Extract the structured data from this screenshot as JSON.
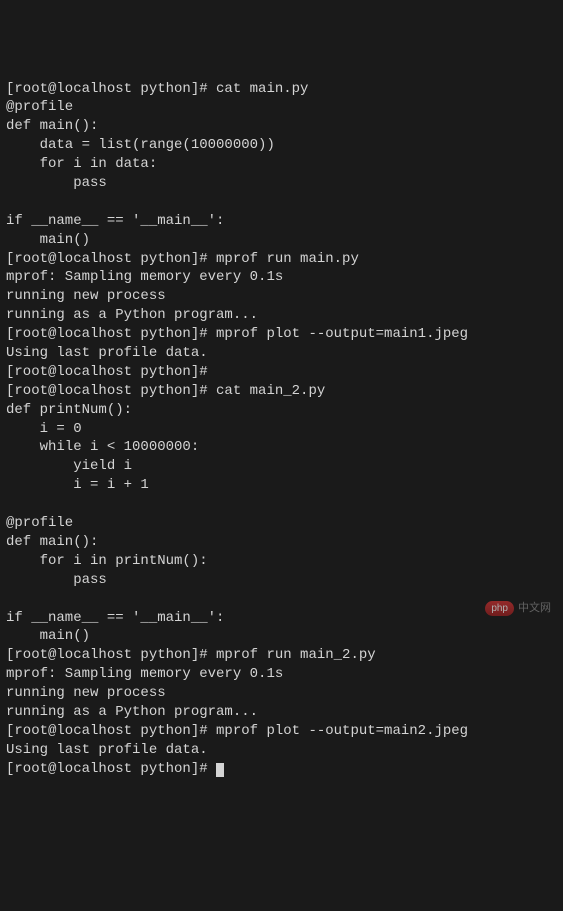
{
  "terminal": {
    "lines": [
      "[root@localhost python]# cat main.py",
      "@profile",
      "def main():",
      "    data = list(range(10000000))",
      "    for i in data:",
      "        pass",
      "",
      "if __name__ == '__main__':",
      "    main()",
      "[root@localhost python]# mprof run main.py",
      "mprof: Sampling memory every 0.1s",
      "running new process",
      "running as a Python program...",
      "[root@localhost python]# mprof plot --output=main1.jpeg",
      "Using last profile data.",
      "[root@localhost python]#",
      "[root@localhost python]# cat main_2.py",
      "def printNum():",
      "    i = 0",
      "    while i < 10000000:",
      "        yield i",
      "        i = i + 1",
      "",
      "@profile",
      "def main():",
      "    for i in printNum():",
      "        pass",
      "",
      "if __name__ == '__main__':",
      "    main()",
      "[root@localhost python]# mprof run main_2.py",
      "mprof: Sampling memory every 0.1s",
      "running new process",
      "running as a Python program...",
      "[root@localhost python]# mprof plot --output=main2.jpeg",
      "Using last profile data.",
      "[root@localhost python]# "
    ]
  },
  "watermark": {
    "badge": "php",
    "text": "中文网"
  }
}
